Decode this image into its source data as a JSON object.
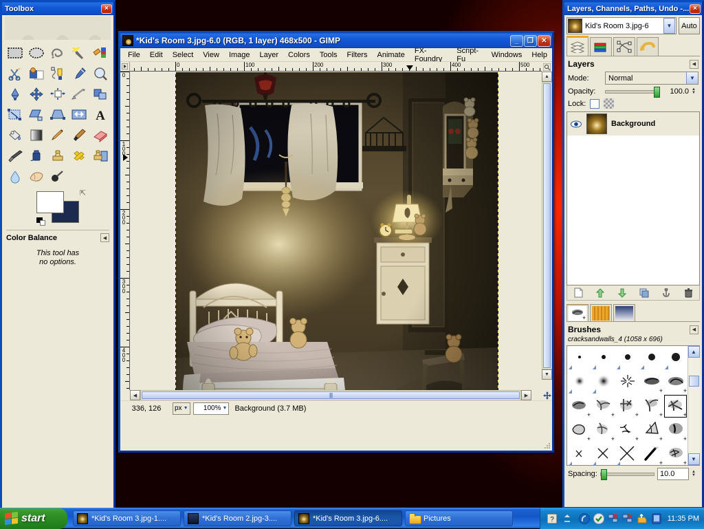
{
  "toolbox": {
    "title": "Toolbox",
    "close_label": "×",
    "tools": [
      {
        "name": "rect-select-tool"
      },
      {
        "name": "ellipse-select-tool"
      },
      {
        "name": "free-select-tool"
      },
      {
        "name": "fuzzy-select-tool"
      },
      {
        "name": "select-by-color-tool"
      },
      {
        "name": "scissors-select-tool"
      },
      {
        "name": "foreground-select-tool"
      },
      {
        "name": "paths-tool"
      },
      {
        "name": "color-picker-tool"
      },
      {
        "name": "zoom-tool"
      },
      {
        "name": "measure-tool"
      },
      {
        "name": "move-tool"
      },
      {
        "name": "alignment-tool"
      },
      {
        "name": "crop-tool"
      },
      {
        "name": "rotate-tool"
      },
      {
        "name": "scale-tool"
      },
      {
        "name": "shear-tool"
      },
      {
        "name": "perspective-tool"
      },
      {
        "name": "flip-tool"
      },
      {
        "name": "text-tool"
      },
      {
        "name": "bucket-fill-tool"
      },
      {
        "name": "blend-gradient-tool"
      },
      {
        "name": "pencil-tool"
      },
      {
        "name": "paintbrush-tool"
      },
      {
        "name": "eraser-tool"
      },
      {
        "name": "airbrush-tool"
      },
      {
        "name": "ink-tool"
      },
      {
        "name": "clone-tool"
      },
      {
        "name": "heal-tool"
      },
      {
        "name": "perspective-clone-tool"
      },
      {
        "name": "blur-sharpen-tool"
      },
      {
        "name": "smudge-tool"
      },
      {
        "name": "dodge-burn-tool"
      }
    ],
    "tool_options": {
      "title": "Color Balance",
      "no_options_line1": "This tool has",
      "no_options_line2": "no options."
    },
    "colors": {
      "foreground": "#ffffff",
      "background": "#1b2a4e"
    }
  },
  "gimp_window": {
    "title": "*Kid's Room 3.jpg-6.0 (RGB, 1 layer) 468x500 - GIMP",
    "minimize_label": "_",
    "maximize_label": "❐",
    "close_label": "✕",
    "menu": [
      "File",
      "Edit",
      "Select",
      "View",
      "Image",
      "Layer",
      "Colors",
      "Tools",
      "Filters",
      "Animate",
      "FX-Foundry",
      "Script-Fu",
      "Windows",
      "Help"
    ],
    "rulers": {
      "h_labels": [
        "0",
        "100",
        "200",
        "300",
        "400",
        "500"
      ],
      "v_labels": [
        "0",
        "100",
        "200",
        "300",
        "400"
      ],
      "unit": "px"
    },
    "statusbar": {
      "pointer_position": "336, 126",
      "unit": "px",
      "zoom": "100%",
      "status": "Background (3.7 MB)"
    }
  },
  "dock": {
    "title": "Layers, Channels, Paths, Undo -...",
    "close_label": "×",
    "image_selector": {
      "value": "Kid's Room 3.jpg-6",
      "auto_label": "Auto"
    },
    "tabs": [
      {
        "name": "layers-tab",
        "label": "Layers"
      },
      {
        "name": "channels-tab",
        "label": "Channels"
      },
      {
        "name": "paths-tab",
        "label": "Paths"
      },
      {
        "name": "undo-history-tab",
        "label": "Undo History"
      }
    ],
    "layers_panel": {
      "title": "Layers",
      "mode_label": "Mode:",
      "mode_value": "Normal",
      "opacity_label": "Opacity:",
      "opacity_value": "100.0",
      "lock_label": "Lock:",
      "layers": [
        {
          "name": "Background",
          "visible": true,
          "selected": true
        }
      ],
      "buttons": [
        "new-layer",
        "raise-layer",
        "lower-layer",
        "duplicate-layer",
        "anchor-layer",
        "delete-layer"
      ]
    },
    "lower_tabs": [
      {
        "name": "brushes-tab",
        "label": "Brushes"
      },
      {
        "name": "patterns-tab",
        "label": "Patterns"
      },
      {
        "name": "gradients-tab",
        "label": "Gradients"
      }
    ],
    "brushes_panel": {
      "title": "Brushes",
      "selected_brush": "cracksandwalls_4 (1058 x 696)",
      "spacing_label": "Spacing:",
      "spacing_value": "10.0"
    }
  },
  "taskbar": {
    "start_label": "start",
    "buttons": [
      {
        "label": "*Kid's Room 3.jpg-1....",
        "icon": "image-thumb",
        "active": false
      },
      {
        "label": "*Kid's Room 2.jpg-3....",
        "icon": "image-thumb",
        "active": false
      },
      {
        "label": "*Kid's Room 3.jpg-6....",
        "icon": "image-thumb",
        "active": true
      },
      {
        "label": "Pictures",
        "icon": "folder",
        "active": false
      }
    ],
    "tray_icons": [
      "help-icon",
      "show-hidden-icon",
      "media-icon",
      "shield-icon",
      "network-disconnected-icon",
      "network-disconnected-icon-2",
      "update-icon",
      "display-icon"
    ],
    "clock": "11:35 PM"
  },
  "theme": {
    "title_blue": "#1359d8",
    "window_face": "#ece9d8",
    "accent_orange": "#f0a728",
    "selection_blue": "#316ac5"
  }
}
